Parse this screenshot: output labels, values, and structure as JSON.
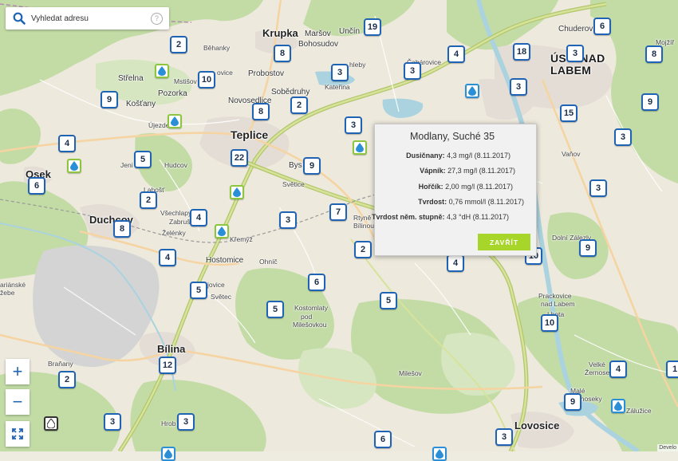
{
  "search": {
    "placeholder": "Vyhledat adresu",
    "help_glyph": "?"
  },
  "zoom": {
    "in_label": "+",
    "out_label": "−",
    "fullscreen_glyph": "⛶"
  },
  "popup": {
    "title": "Modlany, Suché 35",
    "rows": [
      {
        "label": "Dusičnany:",
        "value": "4,3 mg/l (8.11.2017)"
      },
      {
        "label": "Vápník:",
        "value": "27,3 mg/l (8.11.2017)"
      },
      {
        "label": "Hořčík:",
        "value": "2,00 mg/l (8.11.2017)"
      },
      {
        "label": "Tvrdost:",
        "value": "0,76 mmol/l (8.11.2017)"
      },
      {
        "label": "Tvrdost něm. stupně:",
        "value": "4,3 °dH (8.11.2017)"
      }
    ],
    "close_label": "ZAVŘÍT"
  },
  "attribution": "Develo",
  "colors": {
    "cluster_border": "#1f63b4",
    "drop_blue": "#2a8fd6",
    "drop_green": "#8cc63f",
    "button_green": "#a8d52a"
  },
  "places": {
    "krupka": "Krupka",
    "marsov": "Maršov",
    "bohosudov": "Bohosudov",
    "uncin": "Unčín",
    "behanky": "Běhanky",
    "strelna": "Střelna",
    "mstisov": "Mstišov",
    "ovice": "ovice",
    "probostov": "Probostov",
    "pozorka": "Pozorka",
    "kostany": "Košťany",
    "novosedlice": "Novosedlice",
    "sobedruhy": "Sobědruhy",
    "ujezdecek": "Újezdeček",
    "teplice": "Teplice",
    "osek": "Osek",
    "jeni": "Jeni",
    "hudcov": "Hudcov",
    "bys": "Bys",
    "svetice": "Světice",
    "latest": "Lahošť",
    "vsechlapy": "Všechlapy",
    "zabrusany": "Zabrušany",
    "duchcov": "Duchcov",
    "zelenky": "Želénky",
    "kremyz": "Křemýž",
    "hostomice": "Hostomice",
    "ohnic": "Ohníč",
    "jovice": "jovice",
    "svetec": "Světec",
    "kostomlaty": "Kostomlaty",
    "pod": "pod",
    "milesovkou": "Milešovkou",
    "bilina": "Bílina",
    "branany": "Braňany",
    "hrob": "Hrob",
    "milesov": "Milešov",
    "lovosice": "Lovosice",
    "chuderov": "Chuderov",
    "usti1": "ÚSTÍ NAD",
    "usti2": "LABEM",
    "chlebe": "hleby",
    "varov": "Vaňov",
    "dolni_zleb": "Dolní Zálezly",
    "prackovice1": "Prackovice",
    "prackovice2": "nad Labem",
    "lhota": "Lhota",
    "male_zernosky": "Malé Žernoseky",
    "velke": "Velké",
    "zernoseky": "Žernoseky",
    "ulinku": "Libochovany",
    "zaluzi": "Zálužice",
    "rtyne": "Rtyně",
    "bilinou": "Bílinou",
    "mozir": "Mojžíř",
    "narske": "ariánské",
    "zebe": "žebe",
    "katerina": "Kateřina",
    "zbabrovice": "Žabovřesky",
    "tpart": "Čabárovice"
  },
  "clusters": [
    "2",
    "19",
    "6",
    "8",
    "4",
    "18",
    "3",
    "10",
    "3",
    "3",
    "8",
    "9",
    "2",
    "15",
    "8",
    "3",
    "3",
    "4",
    "5",
    "22",
    "9",
    "3",
    "6",
    "2",
    "7",
    "3",
    "4",
    "4",
    "8",
    "2",
    "9",
    "6",
    "10",
    "4",
    "5",
    "5",
    "5",
    "10",
    "12",
    "4",
    "2",
    "3",
    "3",
    "9",
    "1",
    "6",
    "3",
    "9",
    "3"
  ],
  "drop_count": 11
}
